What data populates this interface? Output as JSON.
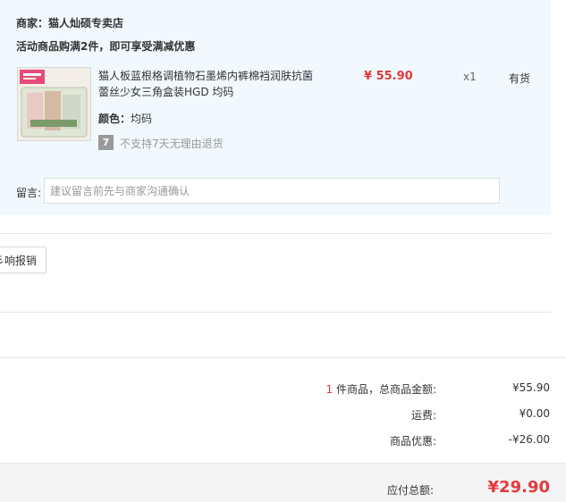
{
  "shop": {
    "merchant": "商家：猫人灿硕专卖店",
    "promo": "活动商品购满2件，即可享受满减优惠"
  },
  "product": {
    "name": "猫人板蓝根格调植物石墨烯内裤棉裆润肤抗菌蕾丝少女三角盒装HGD 均码",
    "price": "¥ 55.90",
    "quantity": "x1",
    "stock": "有货",
    "color_label": "颜色：",
    "color_value": "均码",
    "return_icon": "7",
    "return_policy": "不支持7天无理由退货"
  },
  "message": {
    "label": "留言:",
    "placeholder": "建议留言前先与商家沟通确认"
  },
  "reimburse_button": "彡响报销",
  "summary": {
    "item_count": "1",
    "item_label": " 件商品，总商品金额:",
    "item_amount": "¥55.90",
    "shipping_label": "运费:",
    "shipping_amount": "¥0.00",
    "discount_label": "商品优惠:",
    "discount_amount": "-¥26.00",
    "total_label": "应付总额:",
    "total_amount": "¥29.90"
  },
  "colors": {
    "accent": "#e4393c",
    "panel": "#f1f9fe"
  }
}
